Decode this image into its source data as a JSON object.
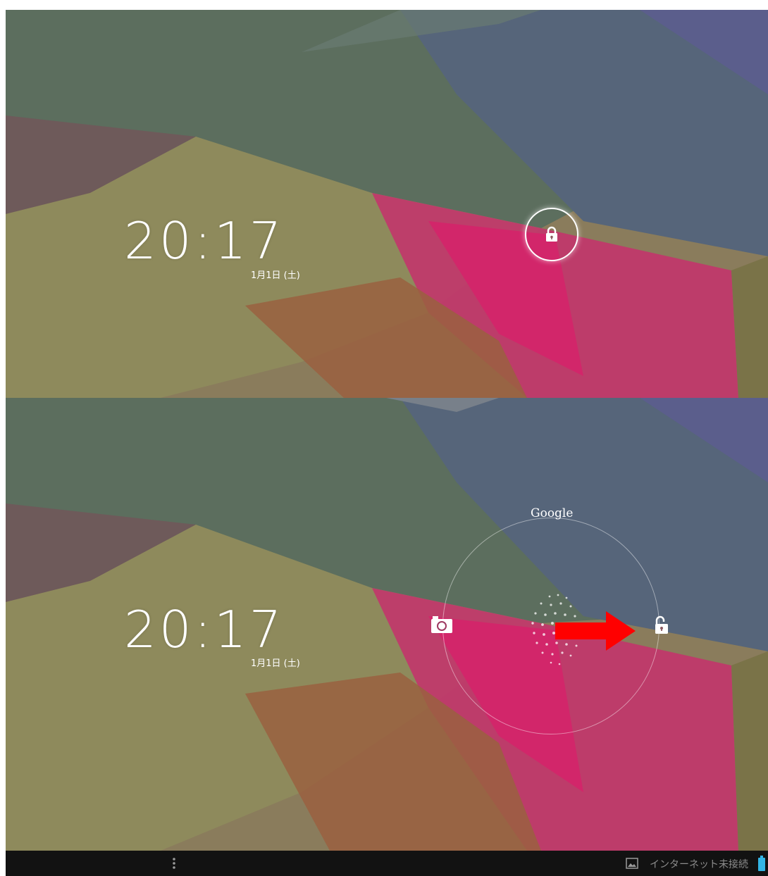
{
  "colors": {
    "navbar_bg": "#121212",
    "navbar_text": "#8c8c8c",
    "arrow": "#ff0000",
    "battery": "#33b5e5",
    "clock_text": "#ffffff"
  },
  "top_screen": {
    "clock": "20:17",
    "date": "1月1日 (土)",
    "lock_icon": "padlock-closed-icon"
  },
  "bottom_screen": {
    "clock": "20:17",
    "date": "1月1日 (土)",
    "google_label": "Google",
    "left_target_icon": "camera-icon",
    "right_target_icon": "padlock-open-icon",
    "annotation_icon": "red-arrow-right"
  },
  "navbar": {
    "menu_icon": "overflow-menu-icon",
    "gallery_icon": "gallery-icon",
    "status_text": "インターネット未接続",
    "battery_icon": "battery-icon"
  }
}
